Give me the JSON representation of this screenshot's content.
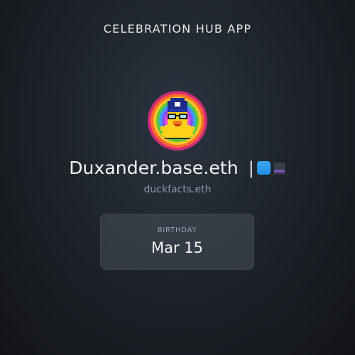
{
  "header": {
    "app_title": "CELEBRATION HUB APP"
  },
  "profile": {
    "avatar_icon": "pixel-duck-avatar-icon",
    "display_name": "Duxander.base.eth",
    "separator": "|",
    "badges": [
      {
        "icon": "blue-square-badge-icon",
        "color": "#2f9cf0"
      },
      {
        "icon": "top-hat-badge-icon",
        "color": "#3a3f4a"
      }
    ],
    "ens_name": "duckfacts.eth"
  },
  "birthday_card": {
    "label": "BIRTHDAY",
    "value": "Mar 15"
  }
}
